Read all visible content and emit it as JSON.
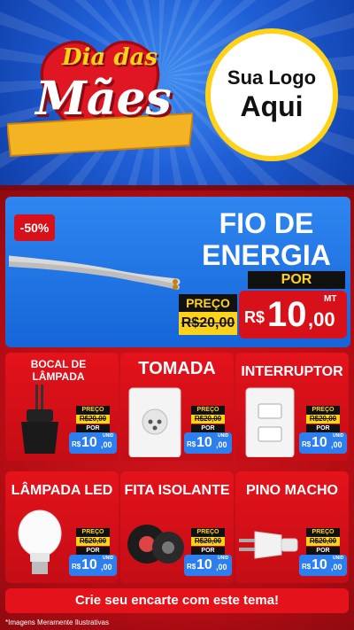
{
  "header": {
    "title_line1": "Dia das",
    "title_line2": "Mães",
    "logo_line1": "Sua Logo",
    "logo_line2": "Aqui"
  },
  "hero": {
    "discount": "-50%",
    "title": "FIO DE ENERGIA",
    "por": "POR",
    "preco_label": "PREÇO",
    "old_price": "R$20,00",
    "currency": "R$",
    "price_int": "10",
    "price_dec": ",00",
    "unit": "MT"
  },
  "products": [
    {
      "name": "BOCAL DE LÂMPADA",
      "preco": "PREÇO",
      "old": "R$20,00",
      "por": "POR",
      "currency": "R$",
      "int": "10",
      "dec": ",00",
      "unit": "UNID",
      "icon": "lamp-socket-icon"
    },
    {
      "name": "TOMADA",
      "preco": "PREÇO",
      "old": "R$20,00",
      "por": "POR",
      "currency": "R$",
      "int": "10",
      "dec": ",00",
      "unit": "UNID",
      "icon": "outlet-icon"
    },
    {
      "name": "INTERRUPTOR",
      "preco": "PREÇO",
      "old": "R$20,00",
      "por": "POR",
      "currency": "R$",
      "int": "10",
      "dec": ",00",
      "unit": "UNID",
      "icon": "switch-icon"
    },
    {
      "name": "LÂMPADA LED",
      "preco": "PREÇO",
      "old": "R$20,00",
      "por": "POR",
      "currency": "R$",
      "int": "10",
      "dec": ",00",
      "unit": "UNID",
      "icon": "led-bulb-icon"
    },
    {
      "name": "FITA ISOLANTE",
      "preco": "PREÇO",
      "old": "R$20,00",
      "por": "POR",
      "currency": "R$",
      "int": "10",
      "dec": ",00",
      "unit": "UNID",
      "icon": "tape-icon"
    },
    {
      "name": "PINO MACHO",
      "preco": "PREÇO",
      "old": "R$20,00",
      "por": "POR",
      "currency": "R$",
      "int": "10",
      "dec": ",00",
      "unit": "UNID",
      "icon": "plug-icon"
    }
  ],
  "banner": "Crie seu encarte com este tema!",
  "disclaimer": "*Imagens Meramente Ilustrativas",
  "colors": {
    "blue": "#1f5fd6",
    "red": "#d8101a",
    "yellow": "#ffd21a"
  }
}
